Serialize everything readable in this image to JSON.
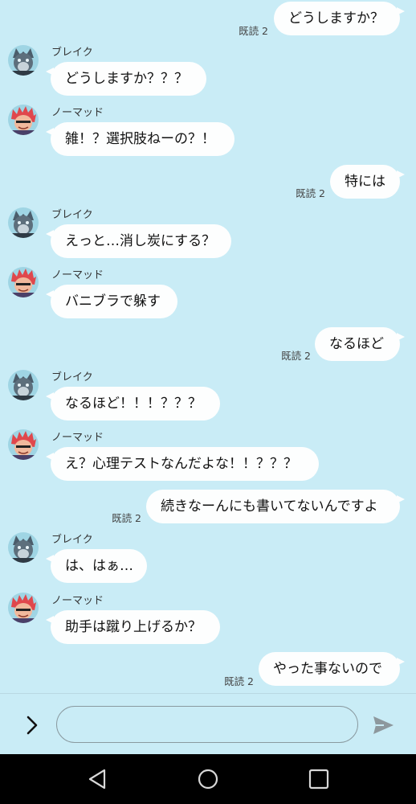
{
  "read_label": "既読 2",
  "senders": {
    "blake": "ブレイク",
    "nomad": "ノーマッド"
  },
  "messages": [
    {
      "side": "out",
      "text": "どうしますか？",
      "read": "既読 2"
    },
    {
      "side": "in",
      "who": "blake",
      "sender": "ブレイク",
      "text": "どうしますか？？？"
    },
    {
      "side": "in",
      "who": "nomad",
      "sender": "ノーマッド",
      "text": "雑！？選択肢ねーの？！"
    },
    {
      "side": "out",
      "text": "特には",
      "read": "既読 2"
    },
    {
      "side": "in",
      "who": "blake",
      "sender": "ブレイク",
      "text": "えっと…消し炭にする？"
    },
    {
      "side": "in",
      "who": "nomad",
      "sender": "ノーマッド",
      "text": "バニブラで躲す"
    },
    {
      "side": "out",
      "text": "なるほど",
      "read": "既読 2"
    },
    {
      "side": "in",
      "who": "blake",
      "sender": "ブレイク",
      "text": "なるほど！！！？？？"
    },
    {
      "side": "in",
      "who": "nomad",
      "sender": "ノーマッド",
      "text": "え？心理テストなんだよな！！？？？"
    },
    {
      "side": "out",
      "text": "続きなーんにも書いてないんですよ",
      "read": "既読 2"
    },
    {
      "side": "in",
      "who": "blake",
      "sender": "ブレイク",
      "text": "は、はぁ…"
    },
    {
      "side": "in",
      "who": "nomad",
      "sender": "ノーマッド",
      "text": "助手は蹴り上げるか？"
    },
    {
      "side": "out",
      "text": "やった事ないので",
      "read": "既読 2"
    }
  ],
  "input": {
    "value": "",
    "placeholder": ""
  },
  "icons": {
    "expand": "chevron-right-icon",
    "send": "send-arrow-icon",
    "nav_back": "triangle-back-icon",
    "nav_home": "circle-home-icon",
    "nav_recent": "square-recents-icon"
  },
  "colors": {
    "background": "#c9ecf6",
    "bubble": "#fdfefe",
    "navbar": "#000000"
  }
}
